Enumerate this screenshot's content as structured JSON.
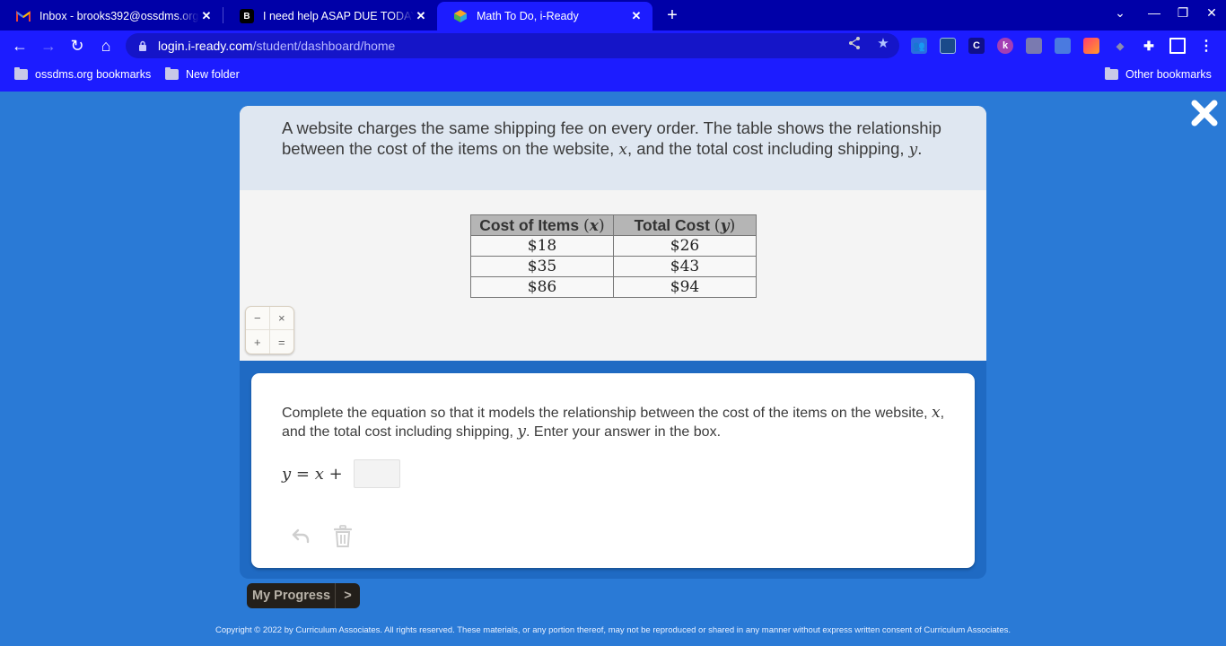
{
  "browser": {
    "tabs": [
      {
        "title": "Inbox - brooks392@ossdms.org",
        "icon": "gmail-icon",
        "active": false
      },
      {
        "title": "I need help ASAP DUE TODAY Pl",
        "icon": "brainly-icon",
        "active": false
      },
      {
        "title": "Math To Do, i-Ready",
        "icon": "iready-icon",
        "active": true
      }
    ],
    "new_tab_glyph": "+",
    "url_host": "login.i-ready.com",
    "url_path": "/student/dashboard/home",
    "bookmarks": [
      {
        "label": "ossdms.org bookmarks",
        "icon": "bookmark-folder-icon"
      },
      {
        "label": "New folder",
        "icon": "folder-icon"
      }
    ],
    "other_bookmarks": "Other bookmarks",
    "extensions": [
      "classroom-extension",
      "screen-extension",
      "c-extension",
      "k-extension",
      "copy-extension",
      "tab-extension",
      "creative-cloud-extension",
      "fish-extension"
    ],
    "accent_color": "#1c1cff"
  },
  "lesson": {
    "prompt": {
      "part1": "A website charges the same shipping fee on every order. The table shows the relationship between the cost of the items on the website, ",
      "var_x": "x",
      "part2": ", and the total cost including shipping, ",
      "var_y": "y",
      "part3": "."
    },
    "table": {
      "headers": [
        {
          "label": "Cost of Items ",
          "var": "x"
        },
        {
          "label": "Total Cost ",
          "var": "y"
        }
      ],
      "rows": [
        [
          "$18",
          "$26"
        ],
        [
          "$35",
          "$43"
        ],
        [
          "$86",
          "$94"
        ]
      ]
    },
    "calculator_keys": [
      "−",
      "×",
      "+",
      "="
    ],
    "instructions": {
      "part1": "Complete the equation so that it models the relationship between the cost of the items on the website, ",
      "var_x": "x",
      "part2": ", and the total cost including shipping, ",
      "var_y": "y",
      "part3": ". Enter your answer in the box."
    },
    "equation_prefix": "y = x +",
    "answer_value": "",
    "my_progress_label": "My Progress",
    "my_progress_arrow": ">",
    "copyright": "Copyright © 2022 by Curriculum Associates. All rights reserved. These materials, or any portion thereof, may not be reproduced or shared in any manner without express written consent of Curriculum Associates."
  }
}
